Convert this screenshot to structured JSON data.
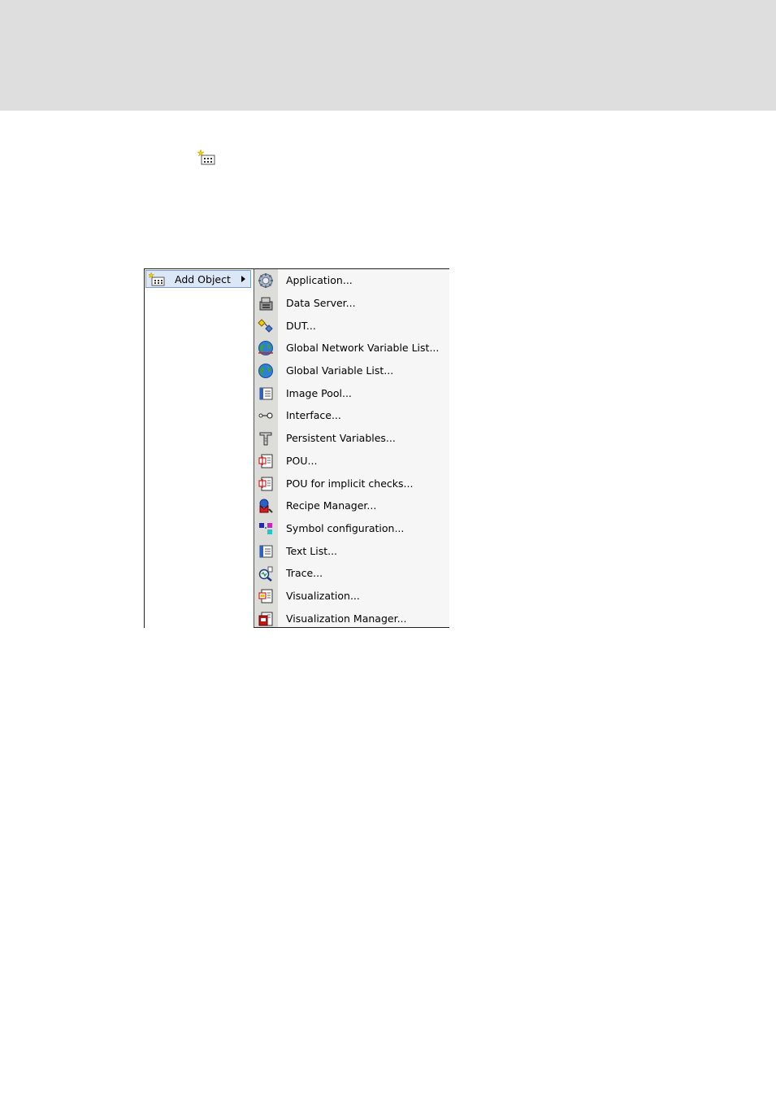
{
  "context_menu": {
    "parent_item": {
      "label": "Add Object",
      "icon": "add-object-icon"
    },
    "submenu_items": [
      {
        "label": "Application...",
        "icon": "application-gear-icon"
      },
      {
        "label": "Data Server...",
        "icon": "data-server-icon"
      },
      {
        "label": "DUT...",
        "icon": "dut-icon"
      },
      {
        "label": "Global Network Variable List...",
        "icon": "globe-network-icon"
      },
      {
        "label": "Global Variable List...",
        "icon": "globe-icon"
      },
      {
        "label": "Image Pool...",
        "icon": "image-pool-icon"
      },
      {
        "label": "Interface...",
        "icon": "interface-icon"
      },
      {
        "label": "Persistent Variables...",
        "icon": "persistent-variables-icon"
      },
      {
        "label": "POU...",
        "icon": "pou-icon"
      },
      {
        "label": "POU for implicit checks...",
        "icon": "pou-checks-icon"
      },
      {
        "label": "Recipe Manager...",
        "icon": "recipe-manager-icon"
      },
      {
        "label": "Symbol configuration...",
        "icon": "symbol-configuration-icon"
      },
      {
        "label": "Text List...",
        "icon": "text-list-icon"
      },
      {
        "label": "Trace...",
        "icon": "trace-icon"
      },
      {
        "label": "Visualization...",
        "icon": "visualization-icon"
      },
      {
        "label": "Visualization Manager...",
        "icon": "visualization-manager-icon"
      }
    ]
  },
  "colors": {
    "highlight_bg": "#dbe6f7",
    "highlight_border": "#7b9bd1",
    "icon_strip": "#dcdcd8",
    "submenu_bg": "#f6f6f6"
  }
}
